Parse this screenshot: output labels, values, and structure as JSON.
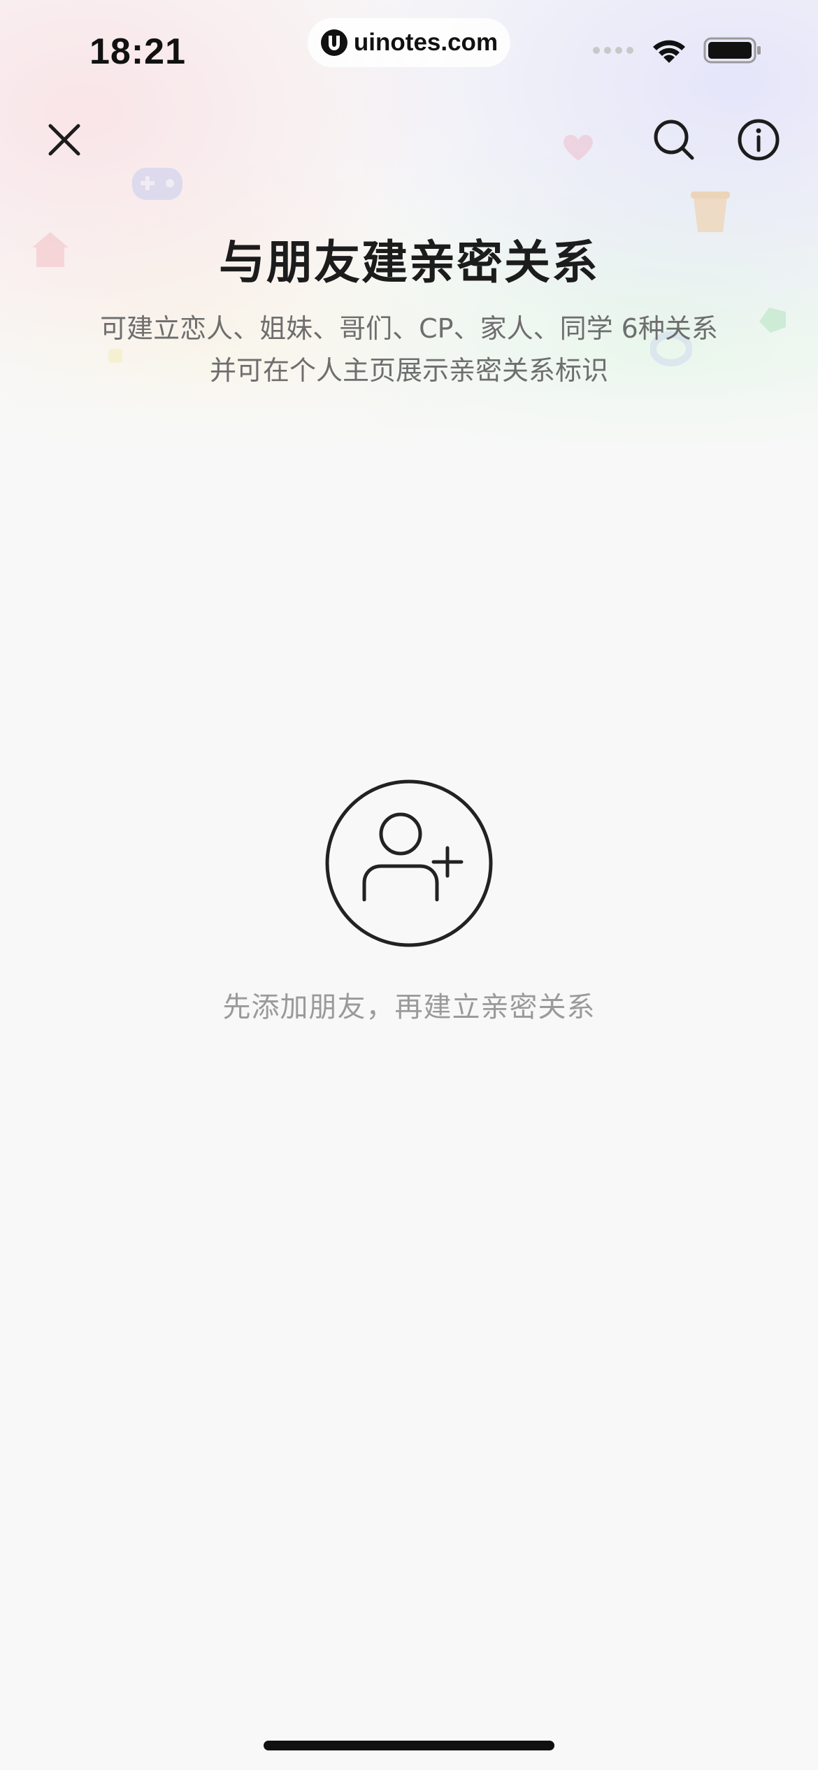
{
  "status_bar": {
    "time": "18:21",
    "url": "uinotes.com",
    "icons": [
      "signal-dots-icon",
      "wifi-icon",
      "battery-icon"
    ]
  },
  "nav": {
    "close_icon": "close-icon",
    "search_icon": "search-icon",
    "info_icon": "info-icon"
  },
  "header": {
    "title": "与朋友建亲密关系",
    "subtitle_line1": "可建立恋人、姐妹、哥们、CP、家人、同学 6种关系",
    "subtitle_line2": "并可在个人主页展示亲密关系标识"
  },
  "empty_state": {
    "icon": "add-friend-icon",
    "message": "先添加朋友，再建立亲密关系"
  },
  "colors": {
    "background": "#f8f8f8",
    "title": "#1c1c1c",
    "subtitle": "#6e6e6e",
    "empty_text": "#9a9a9a"
  }
}
